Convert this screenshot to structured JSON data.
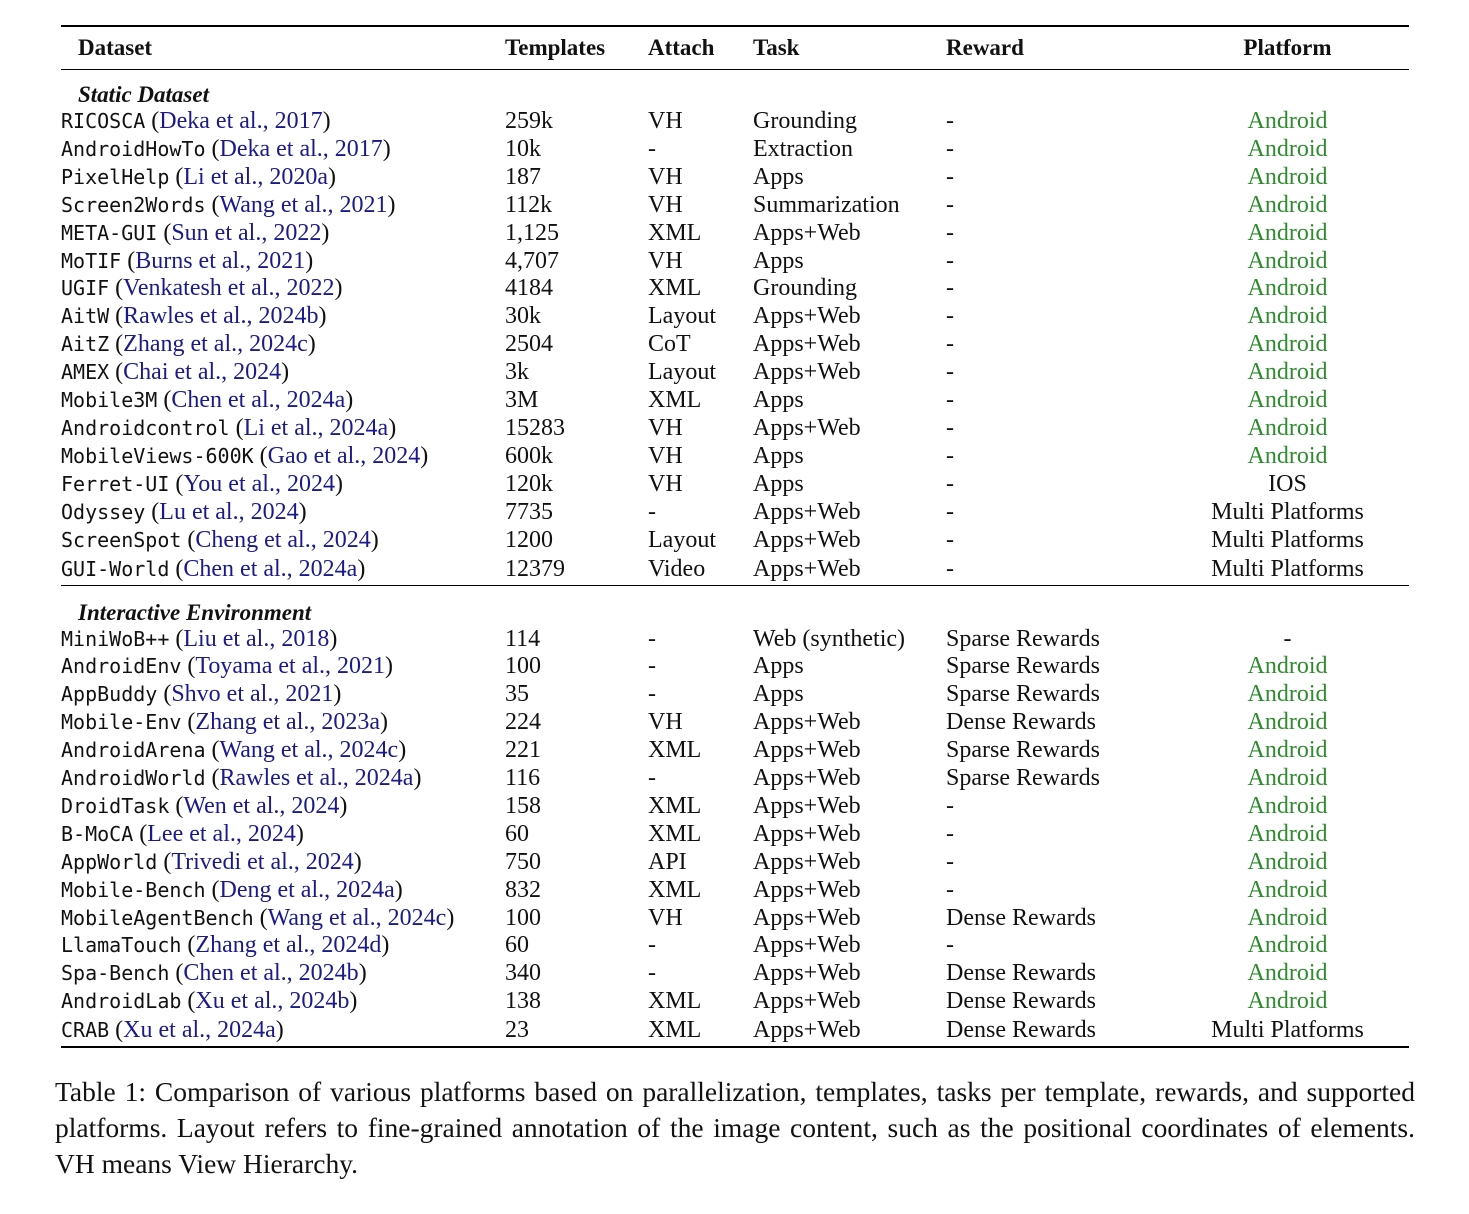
{
  "table": {
    "columns": {
      "dataset": "Dataset",
      "templates": "Templates",
      "attach": "Attach",
      "task": "Task",
      "reward": "Reward",
      "platform": "Platform"
    },
    "sections": [
      {
        "title": "Static Dataset",
        "rows": [
          {
            "name": "RICOSCA",
            "cite": "Deka et al., 2017",
            "templates": "259k",
            "attach": "VH",
            "task": "Grounding",
            "reward": "-",
            "platform": "Android"
          },
          {
            "name": "AndroidHowTo",
            "cite": "Deka et al., 2017",
            "templates": "10k",
            "attach": "-",
            "task": "Extraction",
            "reward": "-",
            "platform": "Android"
          },
          {
            "name": "PixelHelp",
            "cite": "Li et al., 2020a",
            "templates": "187",
            "attach": "VH",
            "task": "Apps",
            "reward": "-",
            "platform": "Android"
          },
          {
            "name": "Screen2Words",
            "cite": "Wang et al., 2021",
            "templates": "112k",
            "attach": "VH",
            "task": "Summarization",
            "reward": "-",
            "platform": "Android"
          },
          {
            "name": "META-GUI",
            "cite": "Sun et al., 2022",
            "templates": "1,125",
            "attach": "XML",
            "task": "Apps+Web",
            "reward": "-",
            "platform": "Android"
          },
          {
            "name": "MoTIF",
            "cite": "Burns et al., 2021",
            "templates": "4,707",
            "attach": "VH",
            "task": "Apps",
            "reward": "-",
            "platform": "Android"
          },
          {
            "name": "UGIF",
            "cite": "Venkatesh et al., 2022",
            "templates": "4184",
            "attach": "XML",
            "task": "Grounding",
            "reward": "-",
            "platform": "Android"
          },
          {
            "name": "AitW",
            "cite": "Rawles et al., 2024b",
            "templates": "30k",
            "attach": "Layout",
            "task": "Apps+Web",
            "reward": "-",
            "platform": "Android"
          },
          {
            "name": "AitZ",
            "cite": "Zhang et al., 2024c",
            "templates": "2504",
            "attach": "CoT",
            "task": "Apps+Web",
            "reward": "-",
            "platform": "Android"
          },
          {
            "name": "AMEX",
            "cite": "Chai et al., 2024",
            "templates": "3k",
            "attach": "Layout",
            "task": "Apps+Web",
            "reward": "-",
            "platform": "Android"
          },
          {
            "name": "Mobile3M",
            "cite": "Chen et al., 2024a",
            "templates": "3M",
            "attach": "XML",
            "task": "Apps",
            "reward": "-",
            "platform": "Android"
          },
          {
            "name": "Androidcontrol",
            "cite": "Li et al., 2024a",
            "templates": "15283",
            "attach": "VH",
            "task": "Apps+Web",
            "reward": "-",
            "platform": "Android"
          },
          {
            "name": "MobileViews-600K",
            "cite": "Gao et al., 2024",
            "templates": "600k",
            "attach": "VH",
            "task": "Apps",
            "reward": "-",
            "platform": "Android"
          },
          {
            "name": "Ferret-UI",
            "cite": "You et al., 2024",
            "templates": "120k",
            "attach": "VH",
            "task": "Apps",
            "reward": "-",
            "platform": "IOS"
          },
          {
            "name": "Odyssey",
            "cite": "Lu et al., 2024",
            "templates": "7735",
            "attach": "-",
            "task": "Apps+Web",
            "reward": "-",
            "platform": "Multi Platforms"
          },
          {
            "name": "ScreenSpot",
            "cite": "Cheng et al., 2024",
            "templates": "1200",
            "attach": "Layout",
            "task": "Apps+Web",
            "reward": "-",
            "platform": "Multi Platforms"
          },
          {
            "name": "GUI-World",
            "cite": "Chen et al., 2024a",
            "templates": "12379",
            "attach": "Video",
            "task": "Apps+Web",
            "reward": "-",
            "platform": "Multi Platforms"
          }
        ]
      },
      {
        "title": "Interactive Environment",
        "rows": [
          {
            "name": "MiniWoB++",
            "cite": "Liu et al., 2018",
            "templates": "114",
            "attach": "-",
            "task": "Web (synthetic)",
            "reward": "Sparse Rewards",
            "platform": "-"
          },
          {
            "name": "AndroidEnv",
            "cite": "Toyama et al., 2021",
            "templates": "100",
            "attach": "-",
            "task": "Apps",
            "reward": "Sparse Rewards",
            "platform": "Android"
          },
          {
            "name": "AppBuddy",
            "cite": "Shvo et al., 2021",
            "templates": "35",
            "attach": "-",
            "task": "Apps",
            "reward": "Sparse Rewards",
            "platform": "Android"
          },
          {
            "name": "Mobile-Env",
            "cite": "Zhang et al., 2023a",
            "templates": "224",
            "attach": "VH",
            "task": "Apps+Web",
            "reward": "Dense Rewards",
            "platform": "Android"
          },
          {
            "name": "AndroidArena",
            "cite": "Wang et al., 2024c",
            "templates": "221",
            "attach": "XML",
            "task": "Apps+Web",
            "reward": "Sparse Rewards",
            "platform": "Android"
          },
          {
            "name": "AndroidWorld",
            "cite": "Rawles et al., 2024a",
            "templates": "116",
            "attach": "-",
            "task": "Apps+Web",
            "reward": "Sparse Rewards",
            "platform": "Android"
          },
          {
            "name": "DroidTask",
            "cite": "Wen et al., 2024",
            "templates": "158",
            "attach": "XML",
            "task": "Apps+Web",
            "reward": "-",
            "platform": "Android"
          },
          {
            "name": "B-MoCA",
            "cite": "Lee et al., 2024",
            "templates": "60",
            "attach": "XML",
            "task": "Apps+Web",
            "reward": "-",
            "platform": "Android"
          },
          {
            "name": "AppWorld",
            "cite": "Trivedi et al., 2024",
            "templates": "750",
            "attach": "API",
            "task": "Apps+Web",
            "reward": "-",
            "platform": "Android"
          },
          {
            "name": "Mobile-Bench",
            "cite": "Deng et al., 2024a",
            "templates": "832",
            "attach": "XML",
            "task": "Apps+Web",
            "reward": "-",
            "platform": "Android"
          },
          {
            "name": "MobileAgentBench",
            "cite": "Wang et al., 2024c",
            "templates": "100",
            "attach": "VH",
            "task": "Apps+Web",
            "reward": "Dense Rewards",
            "platform": "Android"
          },
          {
            "name": "LlamaTouch",
            "cite": "Zhang et al., 2024d",
            "templates": "60",
            "attach": "-",
            "task": "Apps+Web",
            "reward": "-",
            "platform": "Android"
          },
          {
            "name": "Spa-Bench",
            "cite": "Chen et al., 2024b",
            "templates": "340",
            "attach": "-",
            "task": "Apps+Web",
            "reward": "Dense Rewards",
            "platform": "Android"
          },
          {
            "name": "AndroidLab",
            "cite": "Xu et al., 2024b",
            "templates": "138",
            "attach": "XML",
            "task": "Apps+Web",
            "reward": "Dense Rewards",
            "platform": "Android"
          },
          {
            "name": "CRAB",
            "cite": "Xu et al., 2024a",
            "templates": "23",
            "attach": "XML",
            "task": "Apps+Web",
            "reward": "Dense Rewards",
            "platform": "Multi Platforms"
          }
        ]
      }
    ]
  },
  "caption": "Table 1: Comparison of various platforms based on parallelization, templates, tasks per template, rewards, and supported platforms. Layout refers to fine-grained annotation of the image content, such as the positional coordinates of elements. VH means View Hierarchy.",
  "colors": {
    "android": "#2e8b2e",
    "citation": "#1a1a8a",
    "text": "#111111"
  }
}
